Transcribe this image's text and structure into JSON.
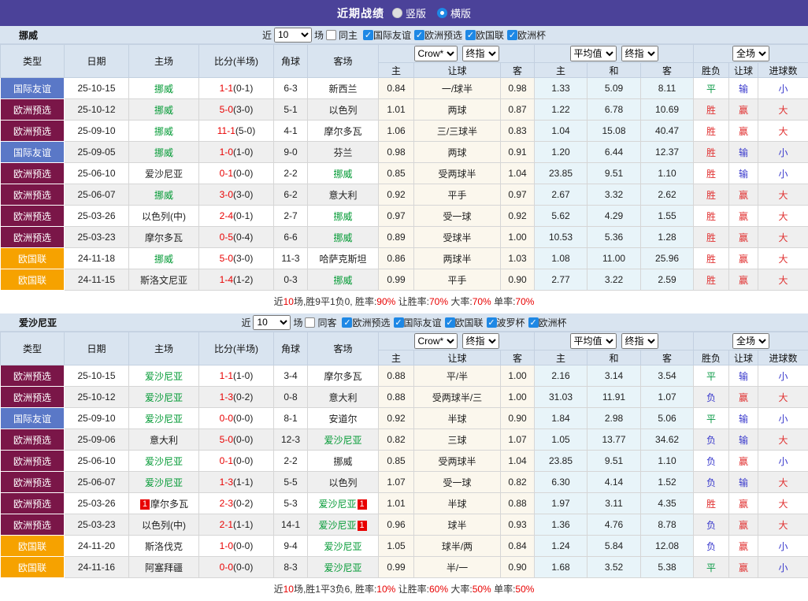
{
  "title_bar": {
    "title": "近期战绩",
    "options": [
      {
        "label": "竖版",
        "selected": false
      },
      {
        "label": "横版",
        "selected": true
      }
    ]
  },
  "table_header": {
    "static_cols": [
      "类型",
      "日期",
      "主场",
      "比分(半场)",
      "角球",
      "客场"
    ],
    "groups": [
      {
        "selects": [
          "Crow*",
          "终指"
        ],
        "cols": [
          "主",
          "让球",
          "客"
        ]
      },
      {
        "selects": [
          "平均值",
          "终指"
        ],
        "cols": [
          "主",
          "和",
          "客"
        ]
      },
      {
        "selects": [
          "全场"
        ],
        "cols": [
          "胜负",
          "让球",
          "进球数"
        ]
      }
    ]
  },
  "colors": {
    "accent_purple": "#4b4299",
    "type_badge": {
      "国际友谊": "#5a78c7",
      "欧洲预选": "#7a1648",
      "欧国联": "#f6a200"
    },
    "result_text": {
      "胜": "#e03030",
      "平": "#089944",
      "负": "#3838cc",
      "赢": "#e03030",
      "输": "#3838cc",
      "大": "#e03030",
      "小": "#3838cc"
    },
    "team_highlight": "#009933",
    "score_red": "#e80000"
  },
  "sections": [
    {
      "team": "挪威",
      "filter": {
        "near_label": "近",
        "count": "10",
        "games_label": "场",
        "same_label": "同主",
        "same_checked": false,
        "competitions": [
          "国际友谊",
          "欧洲预选",
          "欧国联",
          "欧洲杯"
        ]
      },
      "rows": [
        {
          "type": "国际友谊",
          "date": "25-10-15",
          "home": "挪威",
          "home_hl": true,
          "score": "1-1",
          "half": "(0-1)",
          "corner": "6-3",
          "away": "新西兰",
          "away_hl": false,
          "odds": [
            "0.84",
            "一/球半",
            "0.98"
          ],
          "avg": [
            "1.33",
            "5.09",
            "8.11"
          ],
          "results": [
            "平",
            "输",
            "小"
          ]
        },
        {
          "type": "欧洲预选",
          "date": "25-10-12",
          "home": "挪威",
          "home_hl": true,
          "score": "5-0",
          "half": "(3-0)",
          "corner": "5-1",
          "away": "以色列",
          "away_hl": false,
          "odds": [
            "1.01",
            "两球",
            "0.87"
          ],
          "avg": [
            "1.22",
            "6.78",
            "10.69"
          ],
          "results": [
            "胜",
            "赢",
            "大"
          ]
        },
        {
          "type": "欧洲预选",
          "date": "25-09-10",
          "home": "挪威",
          "home_hl": true,
          "score": "11-1",
          "half": "(5-0)",
          "corner": "4-1",
          "away": "摩尔多瓦",
          "away_hl": false,
          "odds": [
            "1.06",
            "三/三球半",
            "0.83"
          ],
          "avg": [
            "1.04",
            "15.08",
            "40.47"
          ],
          "results": [
            "胜",
            "赢",
            "大"
          ]
        },
        {
          "type": "国际友谊",
          "date": "25-09-05",
          "home": "挪威",
          "home_hl": true,
          "score": "1-0",
          "half": "(1-0)",
          "corner": "9-0",
          "away": "芬兰",
          "away_hl": false,
          "odds": [
            "0.98",
            "两球",
            "0.91"
          ],
          "avg": [
            "1.20",
            "6.44",
            "12.37"
          ],
          "results": [
            "胜",
            "输",
            "小"
          ]
        },
        {
          "type": "欧洲预选",
          "date": "25-06-10",
          "home": "爱沙尼亚",
          "home_hl": false,
          "score": "0-1",
          "half": "(0-0)",
          "corner": "2-2",
          "away": "挪威",
          "away_hl": true,
          "odds": [
            "0.85",
            "受两球半",
            "1.04"
          ],
          "avg": [
            "23.85",
            "9.51",
            "1.10"
          ],
          "results": [
            "胜",
            "输",
            "小"
          ]
        },
        {
          "type": "欧洲预选",
          "date": "25-06-07",
          "home": "挪威",
          "home_hl": true,
          "score": "3-0",
          "half": "(3-0)",
          "corner": "6-2",
          "away": "意大利",
          "away_hl": false,
          "odds": [
            "0.92",
            "平手",
            "0.97"
          ],
          "avg": [
            "2.67",
            "3.32",
            "2.62"
          ],
          "results": [
            "胜",
            "赢",
            "大"
          ]
        },
        {
          "type": "欧洲预选",
          "date": "25-03-26",
          "home": "以色列(中)",
          "home_hl": false,
          "score": "2-4",
          "half": "(0-1)",
          "corner": "2-7",
          "away": "挪威",
          "away_hl": true,
          "odds": [
            "0.97",
            "受一球",
            "0.92"
          ],
          "avg": [
            "5.62",
            "4.29",
            "1.55"
          ],
          "results": [
            "胜",
            "赢",
            "大"
          ]
        },
        {
          "type": "欧洲预选",
          "date": "25-03-23",
          "home": "摩尔多瓦",
          "home_hl": false,
          "score": "0-5",
          "half": "(0-4)",
          "corner": "6-6",
          "away": "挪威",
          "away_hl": true,
          "odds": [
            "0.89",
            "受球半",
            "1.00"
          ],
          "avg": [
            "10.53",
            "5.36",
            "1.28"
          ],
          "results": [
            "胜",
            "赢",
            "大"
          ]
        },
        {
          "type": "欧国联",
          "date": "24-11-18",
          "home": "挪威",
          "home_hl": true,
          "score": "5-0",
          "half": "(3-0)",
          "corner": "11-3",
          "away": "哈萨克斯坦",
          "away_hl": false,
          "odds": [
            "0.86",
            "两球半",
            "1.03"
          ],
          "avg": [
            "1.08",
            "11.00",
            "25.96"
          ],
          "results": [
            "胜",
            "赢",
            "大"
          ]
        },
        {
          "type": "欧国联",
          "date": "24-11-15",
          "home": "斯洛文尼亚",
          "home_hl": false,
          "score": "1-4",
          "half": "(1-2)",
          "corner": "0-3",
          "away": "挪威",
          "away_hl": true,
          "odds": [
            "0.99",
            "平手",
            "0.90"
          ],
          "avg": [
            "2.77",
            "3.22",
            "2.59"
          ],
          "results": [
            "胜",
            "赢",
            "大"
          ]
        }
      ],
      "summary": [
        {
          "t": "近",
          "red": false
        },
        {
          "t": "10",
          "red": true
        },
        {
          "t": "场,胜9平1负0, 胜率:",
          "red": false
        },
        {
          "t": "90%",
          "red": true
        },
        {
          "t": " 让胜率:",
          "red": false
        },
        {
          "t": "70%",
          "red": true
        },
        {
          "t": " 大率:",
          "red": false
        },
        {
          "t": "70%",
          "red": true
        },
        {
          "t": " 单率:",
          "red": false
        },
        {
          "t": "70%",
          "red": true
        }
      ]
    },
    {
      "team": "爱沙尼亚",
      "filter": {
        "near_label": "近",
        "count": "10",
        "games_label": "场",
        "same_label": "同客",
        "same_checked": false,
        "competitions": [
          "欧洲预选",
          "国际友谊",
          "欧国联",
          "波罗杯",
          "欧洲杯"
        ]
      },
      "rows": [
        {
          "type": "欧洲预选",
          "date": "25-10-15",
          "home": "爱沙尼亚",
          "home_hl": true,
          "score": "1-1",
          "half": "(1-0)",
          "corner": "3-4",
          "away": "摩尔多瓦",
          "away_hl": false,
          "odds": [
            "0.88",
            "平/半",
            "1.00"
          ],
          "avg": [
            "2.16",
            "3.14",
            "3.54"
          ],
          "results": [
            "平",
            "输",
            "小"
          ]
        },
        {
          "type": "欧洲预选",
          "date": "25-10-12",
          "home": "爱沙尼亚",
          "home_hl": true,
          "score": "1-3",
          "half": "(0-2)",
          "corner": "0-8",
          "away": "意大利",
          "away_hl": false,
          "odds": [
            "0.88",
            "受两球半/三",
            "1.00"
          ],
          "avg": [
            "31.03",
            "11.91",
            "1.07"
          ],
          "results": [
            "负",
            "赢",
            "大"
          ]
        },
        {
          "type": "国际友谊",
          "date": "25-09-10",
          "home": "爱沙尼亚",
          "home_hl": true,
          "score": "0-0",
          "half": "(0-0)",
          "corner": "8-1",
          "away": "安道尔",
          "away_hl": false,
          "odds": [
            "0.92",
            "半球",
            "0.90"
          ],
          "avg": [
            "1.84",
            "2.98",
            "5.06"
          ],
          "results": [
            "平",
            "输",
            "小"
          ]
        },
        {
          "type": "欧洲预选",
          "date": "25-09-06",
          "home": "意大利",
          "home_hl": false,
          "score": "5-0",
          "half": "(0-0)",
          "corner": "12-3",
          "away": "爱沙尼亚",
          "away_hl": true,
          "odds": [
            "0.82",
            "三球",
            "1.07"
          ],
          "avg": [
            "1.05",
            "13.77",
            "34.62"
          ],
          "results": [
            "负",
            "输",
            "大"
          ]
        },
        {
          "type": "欧洲预选",
          "date": "25-06-10",
          "home": "爱沙尼亚",
          "home_hl": true,
          "score": "0-1",
          "half": "(0-0)",
          "corner": "2-2",
          "away": "挪威",
          "away_hl": false,
          "odds": [
            "0.85",
            "受两球半",
            "1.04"
          ],
          "avg": [
            "23.85",
            "9.51",
            "1.10"
          ],
          "results": [
            "负",
            "赢",
            "小"
          ]
        },
        {
          "type": "欧洲预选",
          "date": "25-06-07",
          "home": "爱沙尼亚",
          "home_hl": true,
          "score": "1-3",
          "half": "(1-1)",
          "corner": "5-5",
          "away": "以色列",
          "away_hl": false,
          "odds": [
            "1.07",
            "受一球",
            "0.82"
          ],
          "avg": [
            "6.30",
            "4.14",
            "1.52"
          ],
          "results": [
            "负",
            "输",
            "大"
          ]
        },
        {
          "type": "欧洲预选",
          "date": "25-03-26",
          "home": "摩尔多瓦",
          "home_hl": false,
          "home_card_before": "1",
          "score": "2-3",
          "half": "(0-2)",
          "corner": "5-3",
          "away": "爱沙尼亚",
          "away_hl": true,
          "away_card_after": "1",
          "odds": [
            "1.01",
            "半球",
            "0.88"
          ],
          "avg": [
            "1.97",
            "3.11",
            "4.35"
          ],
          "results": [
            "胜",
            "赢",
            "大"
          ]
        },
        {
          "type": "欧洲预选",
          "date": "25-03-23",
          "home": "以色列(中)",
          "home_hl": false,
          "score": "2-1",
          "half": "(1-1)",
          "corner": "14-1",
          "away": "爱沙尼亚",
          "away_hl": true,
          "away_card_after": "1",
          "odds": [
            "0.96",
            "球半",
            "0.93"
          ],
          "avg": [
            "1.36",
            "4.76",
            "8.78"
          ],
          "results": [
            "负",
            "赢",
            "大"
          ]
        },
        {
          "type": "欧国联",
          "date": "24-11-20",
          "home": "斯洛伐克",
          "home_hl": false,
          "score": "1-0",
          "half": "(0-0)",
          "corner": "9-4",
          "away": "爱沙尼亚",
          "away_hl": true,
          "odds": [
            "1.05",
            "球半/两",
            "0.84"
          ],
          "avg": [
            "1.24",
            "5.84",
            "12.08"
          ],
          "results": [
            "负",
            "赢",
            "小"
          ]
        },
        {
          "type": "欧国联",
          "date": "24-11-16",
          "home": "阿塞拜疆",
          "home_hl": false,
          "score": "0-0",
          "half": "(0-0)",
          "corner": "8-3",
          "away": "爱沙尼亚",
          "away_hl": true,
          "odds": [
            "0.99",
            "半/一",
            "0.90"
          ],
          "avg": [
            "1.68",
            "3.52",
            "5.38"
          ],
          "results": [
            "平",
            "赢",
            "小"
          ]
        }
      ],
      "summary": [
        {
          "t": "近",
          "red": false
        },
        {
          "t": "10",
          "red": true
        },
        {
          "t": "场,胜1平3负6, 胜率:",
          "red": false
        },
        {
          "t": "10%",
          "red": true
        },
        {
          "t": " 让胜率:",
          "red": false
        },
        {
          "t": "60%",
          "red": true
        },
        {
          "t": " 大率:",
          "red": false
        },
        {
          "t": "50%",
          "red": true
        },
        {
          "t": " 单率:",
          "red": false
        },
        {
          "t": "50%",
          "red": true
        }
      ]
    }
  ]
}
